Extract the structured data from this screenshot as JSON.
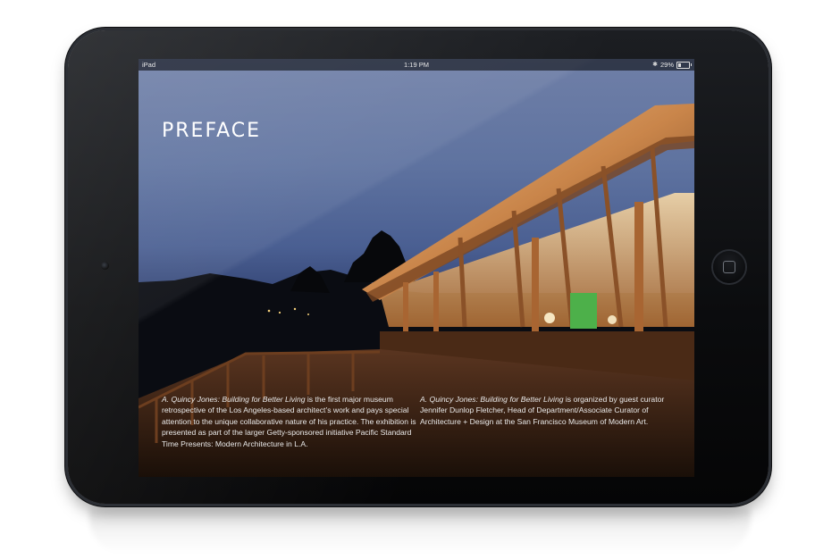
{
  "status_bar": {
    "device": "iPad",
    "time": "1:19 PM",
    "battery": "29%",
    "battery_level": 0.29,
    "bluetooth_icon": "bluetooth-icon"
  },
  "page": {
    "title": "PREFACE",
    "col1": {
      "italic": "A. Quincy Jones: Building for Better Living",
      "text": " is the first major museum retrospective of the Los Angeles-based architect’s work and pays special attention to the unique collaborative nature of his practice. The exhibition is presented as part of the larger Getty-sponsored initiative Pacific Standard Time Presents: Modern Architecture in L.A."
    },
    "col2": {
      "italic": "A. Quincy Jones: Building for Better Living",
      "text": " is organized by guest curator Jennifer Dunlop Fletcher, Head of Department/Associate Curator of Architecture + Design at the San Francisco Museum of Modern Art."
    }
  },
  "colors": {
    "bezel": "#0b0c0e",
    "text": "#e9e9e9",
    "sky_top": "#6f7fa7",
    "wood": "#c9854a"
  }
}
